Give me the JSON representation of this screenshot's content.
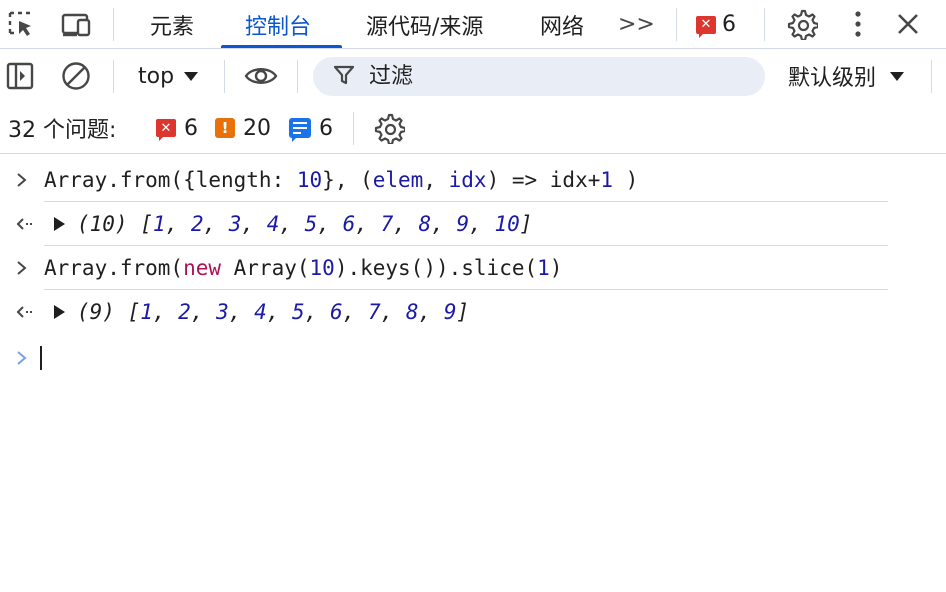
{
  "tabbar": {
    "tabs": [
      {
        "label": "元素"
      },
      {
        "label": "控制台"
      },
      {
        "label": "源代码/来源"
      },
      {
        "label": "网络"
      }
    ],
    "active_tab": "控制台",
    "more_tabs_label": ">>",
    "error_count": "6"
  },
  "toolbar": {
    "context": "top",
    "filter_placeholder": "过滤",
    "levels_label": "默认级别"
  },
  "issues": {
    "label": "32 个问题:",
    "errors": "6",
    "warnings": "20",
    "info": "6"
  },
  "console": {
    "entries": [
      {
        "type": "input",
        "text": "Array.from({length: 10}, (elem, idx) => idx+1 )"
      },
      {
        "type": "result",
        "text": "(10) [1, 2, 3, 4, 5, 6, 7, 8, 9, 10]"
      },
      {
        "type": "input",
        "text": "Array.from(new Array(10).keys()).slice(1)"
      },
      {
        "type": "result",
        "text": "(9) [1, 2, 3, 4, 5, 6, 7, 8, 9]"
      }
    ]
  },
  "colors": {
    "accent": "#0b57d0",
    "error": "#dc362e",
    "warning": "#e8710a",
    "info": "#1a73e8",
    "number": "#1a1aa6",
    "keyword": "#ad1457"
  }
}
